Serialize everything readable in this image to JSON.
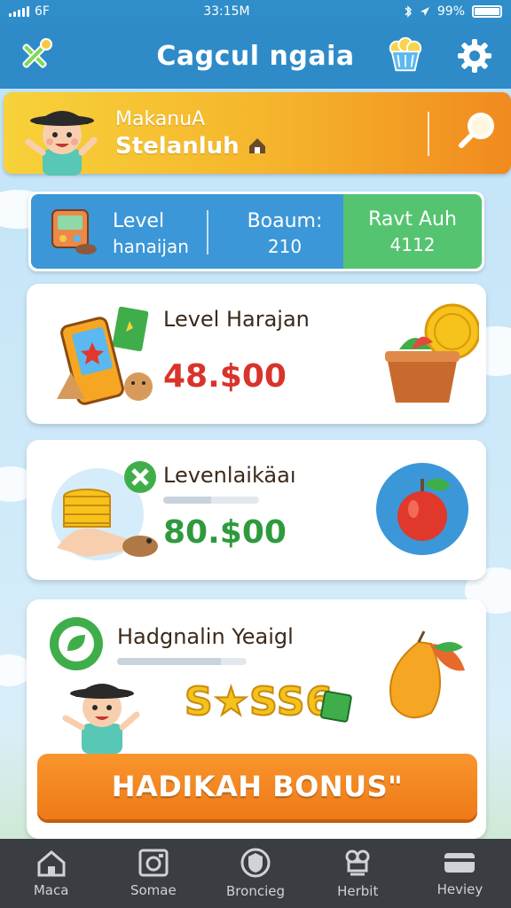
{
  "status_bar": {
    "carrier": "6F",
    "time": "33:15M",
    "battery": "99%",
    "battery_level": 0.99
  },
  "header": {
    "title": "Cagcul ngaia",
    "left_icon": "crossed-tools-icon",
    "shop_icon": "popcorn-bucket-icon",
    "settings_icon": "gear-icon"
  },
  "banner": {
    "line1": "MakanuA",
    "line2": "Stelanluh",
    "search_icon": "search-icon"
  },
  "stats": {
    "level_label": "Level",
    "level_value": "hanaijan",
    "bonus_label": "Boaum:",
    "bonus_value": "210",
    "right_label": "Ravt Auh",
    "right_value": "4112"
  },
  "cards": [
    {
      "title": "Level Harajan",
      "price": "48.$00"
    },
    {
      "title": "Levenlaikäaı",
      "price": "80.$00",
      "progress": 0.5
    },
    {
      "title": "Hadgnalin Yeaigl",
      "stars_text": "S★SS6",
      "progress": 0.8
    }
  ],
  "bonus_button": {
    "label": "HADIKAH BONUS\""
  },
  "nav": [
    {
      "label": "Maca",
      "icon": "home-icon"
    },
    {
      "label": "Somae",
      "icon": "camera-icon"
    },
    {
      "label": "Broncieg",
      "icon": "shield-icon"
    },
    {
      "label": "Herbit",
      "icon": "chef-icon"
    },
    {
      "label": "Heviey",
      "icon": "card-icon"
    }
  ]
}
